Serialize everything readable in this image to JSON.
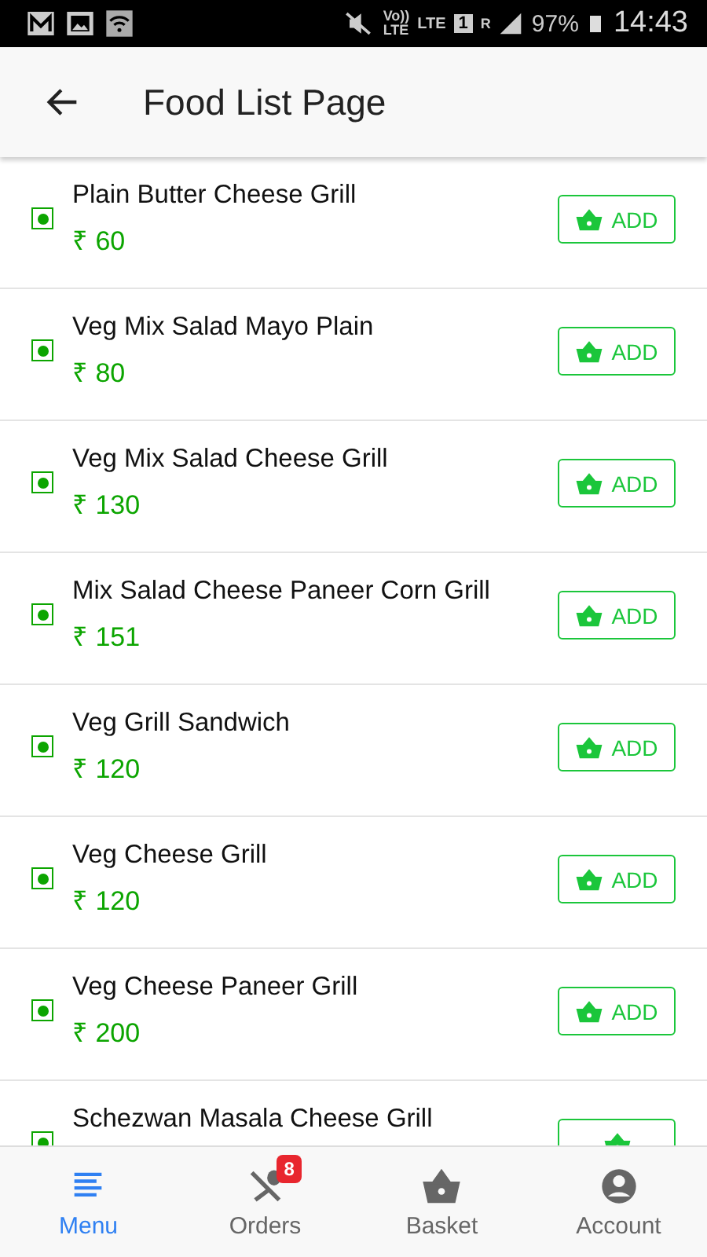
{
  "status_bar": {
    "volte": [
      "Vo))",
      "LTE"
    ],
    "lte": "LTE",
    "sim": "1",
    "roaming": "R",
    "battery": "97%",
    "time": "14:43"
  },
  "app_bar": {
    "title": "Food List Page"
  },
  "items": [
    {
      "name": "Plain Butter Cheese Grill",
      "price": "₹ 60",
      "button": "ADD"
    },
    {
      "name": "Veg Mix Salad Mayo Plain",
      "price": "₹ 80",
      "button": "ADD"
    },
    {
      "name": "Veg Mix Salad Cheese Grill",
      "price": "₹ 130",
      "button": "ADD"
    },
    {
      "name": "Mix Salad Cheese Paneer Corn Grill",
      "price": "₹ 151",
      "button": "ADD"
    },
    {
      "name": "Veg Grill Sandwich",
      "price": "₹ 120",
      "button": "ADD"
    },
    {
      "name": "Veg Cheese Grill",
      "price": "₹ 120",
      "button": "ADD"
    },
    {
      "name": "Veg Cheese Paneer Grill",
      "price": "₹ 200",
      "button": "ADD"
    },
    {
      "name": "Schezwan Masala Cheese Grill"
    }
  ],
  "nav": [
    {
      "kind": "menu",
      "label": "Menu",
      "selected": true
    },
    {
      "kind": "orders",
      "label": "Orders",
      "selected": false,
      "badge": "8"
    },
    {
      "kind": "basket",
      "label": "Basket",
      "selected": false
    },
    {
      "kind": "account",
      "label": "Account",
      "selected": false
    }
  ]
}
